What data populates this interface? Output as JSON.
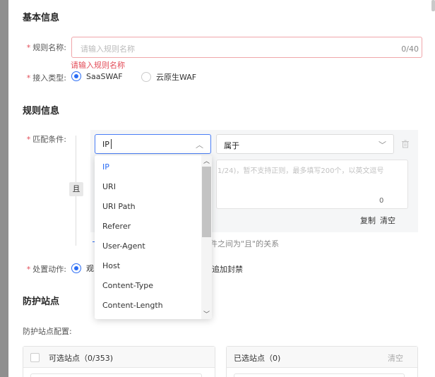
{
  "basic": {
    "title": "基本信息",
    "name_label": "规则名称:",
    "name_placeholder": "请输入规则名称",
    "name_count": "0/40",
    "name_error": "请输入规则名称",
    "access_label": "接入类型:",
    "access_options": [
      "SaaSWAF",
      "云原生WAF"
    ],
    "access_selected": "SaaSWAF"
  },
  "rule": {
    "title": "规则信息",
    "match_label": "匹配条件:",
    "and_badge": "且",
    "field_value": "IP",
    "operator_value": "属于",
    "textarea_hint": "1/24)，暂不支持正则，最多填写200个，以英文逗号",
    "textarea_count": "0",
    "copy": "复制",
    "clear": "清空",
    "relation_hint": "件之间为\"且\"的关系",
    "action_label": "处置动作:",
    "action_option_1": "观",
    "action_option_2": "追加封禁"
  },
  "dropdown": {
    "items": [
      "IP",
      "URI",
      "URI Path",
      "Referer",
      "User-Agent",
      "Host",
      "Content-Type",
      "Content-Length"
    ],
    "active": "IP"
  },
  "sites": {
    "title": "防护站点",
    "config_label": "防护站点配置:",
    "available": "可选站点（0/353)",
    "selected": "已选站点（0)",
    "clear": "清空"
  },
  "icons": {
    "chevron_up": "chevron-up-icon",
    "chevron_down": "chevron-down-icon",
    "trash": "trash-icon"
  },
  "colors": {
    "primary": "#2a6cf4",
    "error": "#e34d59"
  }
}
